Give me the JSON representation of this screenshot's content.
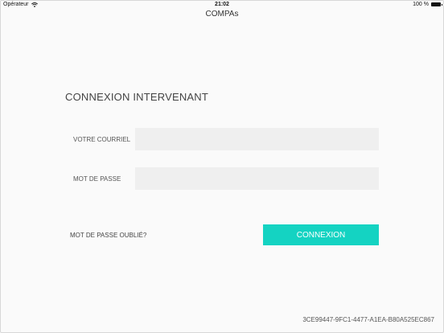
{
  "status_bar": {
    "carrier": "Opérateur",
    "time": "21:02",
    "battery": "100 %"
  },
  "nav": {
    "title": "COMPAs"
  },
  "login": {
    "heading": "CONNEXION INTERVENANT",
    "email_label": "VOTRE COURRIEL",
    "email_value": "",
    "password_label": "MOT DE PASSE",
    "password_value": "",
    "forgot_label": "MOT DE PASSE OUBLIÉ?",
    "connect_label": "CONNEXION"
  },
  "footer": {
    "device_id": "3CE99447-9FC1-4477-A1EA-B80A525EC867"
  },
  "colors": {
    "accent": "#14d3c2",
    "input_bg": "#efefef"
  },
  "icons": {
    "wifi": "wifi-icon",
    "battery": "battery-icon"
  }
}
